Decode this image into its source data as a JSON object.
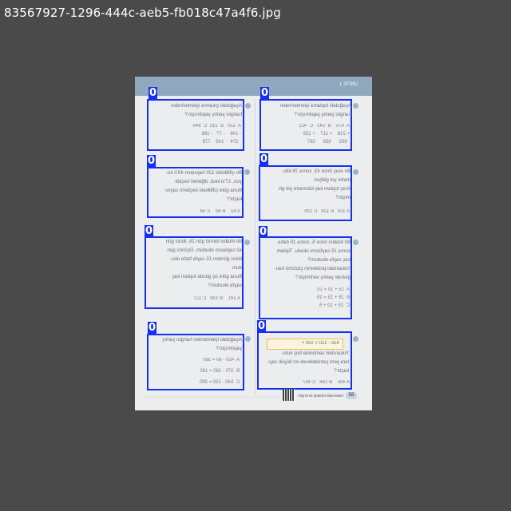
{
  "filename": "83567927-1296-444c-aeb5-fb018c47a4f6.jpg",
  "page": {
    "header_label": "ÜNİTE 1",
    "page_number": "58",
    "footer_text": "Matematik Kitabığı ile Erişim"
  },
  "boxes": [
    {
      "tag": "0",
      "text": "Aşağıdaki toplama işlemlerinden\nhangisi yanlış yapılmıştır?",
      "options": "A  475    B  541   C  412\n+ 218    + 117    + 155\n  693      658      567"
    },
    {
      "tag": "0",
      "text": "Aşağıdaki çıkarma işlemlerinden\nhangisi yanlış yapılmıştır?",
      "options": "A  520   B  210  C  944\n- 146    - 77   - 166\n  374     143    778"
    },
    {
      "tag": "0",
      "text": "Bir araç önce 43, sonra 76 kilo-\nmetre yol gidiyor.\nAraç toplam kaç kilometre yol git-\nmiştir?",
      "options": "A 119   B 129   C 139"
    },
    {
      "tag": "0",
      "text": "Bir çiftlikteki 120 hayvanın 43'ü ko-\nyun, 17'si kedi, diğerleri keçidir.\nBuna göre çiftlikteki keçilerin sayısı\nkaçtır?",
      "options": "A 62    B 60    C 58"
    },
    {
      "tag": "0",
      "text": "Bir kitabın önce 5, sonra 15 daha\nsonra 15 sayfasını okudu. Toplam\nkaç sayfa okudum?\nYukarıdaki problemin çözümü han-\ngisinde yanlış verilmiştir?",
      "options": "A  15 + 10 = 10\nB  15 + 15 = 15\nC  15 + 10 + 5"
    },
    {
      "tag": "0",
      "text": "Bir kitabın birinci gün 28, ikinci gün\n42 sayfasını okudum. Üçüncü gün\nikinci günden 15 sayfa fazla oku-\ndum.\nBuna göre üç günde toplam kaç\nsayfa okudum?",
      "options": "A 141    B 139   C 127"
    },
    {
      "tag": "0",
      "text": "Yukarıdaki sembolde boş kuto-\nlara yere yazılabilecek en büyük sayı\nkaçtır?",
      "equation": "416 - 120 > 100 +",
      "options": "A 435    B 196   C 437"
    },
    {
      "tag": "0",
      "text": "Aşağıdaki işlemlerden hangisi yanlış\nyapılmıştır?",
      "options": "A  420 - 60 = 360\nB  370 - 180 = 180\nC  540 - 150 = 390"
    }
  ],
  "colors": {
    "box": "#1530f0",
    "background": "#4a4a4a",
    "highlight": "#2f8a4e"
  }
}
